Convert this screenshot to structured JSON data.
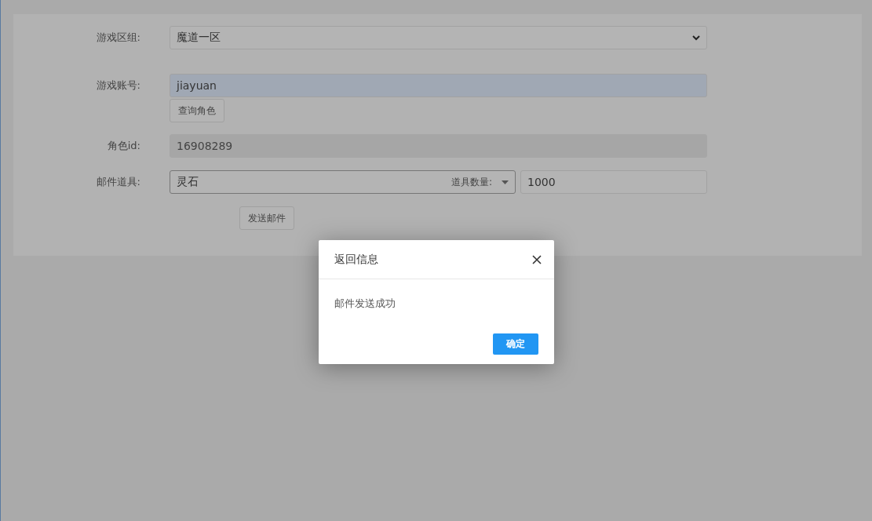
{
  "form": {
    "server": {
      "label": "游戏区组:",
      "value": "魔道一区"
    },
    "account": {
      "label": "游戏账号:",
      "value": "jiayuan",
      "autofilled": true
    },
    "query_button": "查询角色",
    "role_id": {
      "label": "角色id:",
      "value": "16908289",
      "disabled": true
    },
    "mail_item": {
      "label": "邮件道具:",
      "item": "灵石",
      "quantity_label": "道具数量:",
      "quantity": "1000"
    },
    "send_button": "发送邮件"
  },
  "dialog": {
    "title": "返回信息",
    "message": "邮件发送成功",
    "ok_button": "确定"
  }
}
